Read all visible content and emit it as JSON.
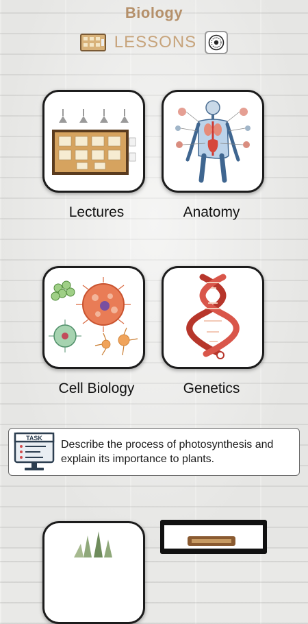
{
  "header": {
    "app_title": "Biology",
    "section_title": "LESSONS",
    "board_icon": "bulletin-board-icon",
    "settings_icon": "dial-icon"
  },
  "tiles": [
    {
      "label": "Lectures",
      "icon": "lecture-board-icon"
    },
    {
      "label": "Anatomy",
      "icon": "human-anatomy-icon"
    },
    {
      "label": "Cell Biology",
      "icon": "cells-icon"
    },
    {
      "label": "Genetics",
      "icon": "dna-helix-icon"
    }
  ],
  "task": {
    "badge": "TASK",
    "text": "Describe the process of photosynthesis and explain its importance to plants.",
    "icon": "task-monitor-icon"
  },
  "lower_tiles": [
    {
      "icon": "plant-icon"
    },
    {
      "icon": "books-icon"
    }
  ],
  "colors": {
    "title": "#b5906a",
    "lessons": "#c7a47c",
    "tile_border": "#1c1c1c",
    "wall": "#e9e9e7"
  }
}
